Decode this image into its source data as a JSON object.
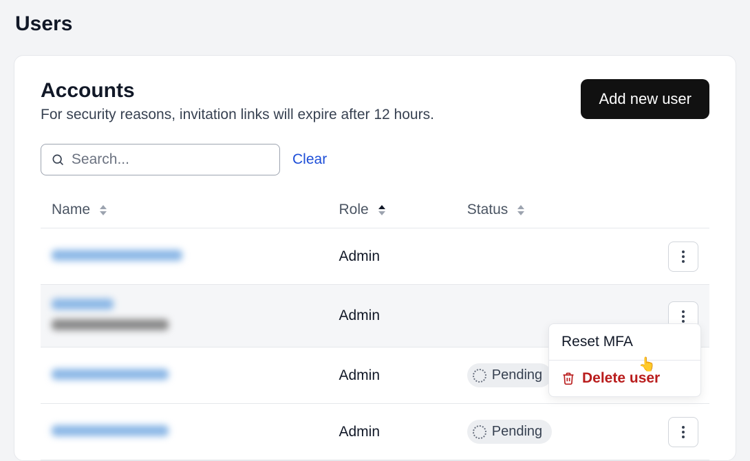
{
  "page": {
    "title": "Users"
  },
  "card": {
    "heading": "Accounts",
    "subheading": "For security reasons, invitation links will expire after 12 hours.",
    "add_button": "Add new user"
  },
  "search": {
    "placeholder": "Search...",
    "clear": "Clear"
  },
  "columns": {
    "name": "Name",
    "role": "Role",
    "status": "Status",
    "sort_active": "role_asc"
  },
  "status_labels": {
    "pending": "Pending"
  },
  "rows": [
    {
      "name_redacted_width": 190,
      "role": "Admin",
      "status": ""
    },
    {
      "name_redacted_width": 90,
      "secondary_redacted_width": 170,
      "role": "Admin",
      "status": "",
      "highlighted": true,
      "menu_open": true
    },
    {
      "name_redacted_width": 170,
      "role": "Admin",
      "status": "pending"
    },
    {
      "name_redacted_width": 170,
      "role": "Admin",
      "status": "pending"
    }
  ],
  "row_menu": {
    "reset_mfa": "Reset MFA",
    "delete_user": "Delete user"
  }
}
